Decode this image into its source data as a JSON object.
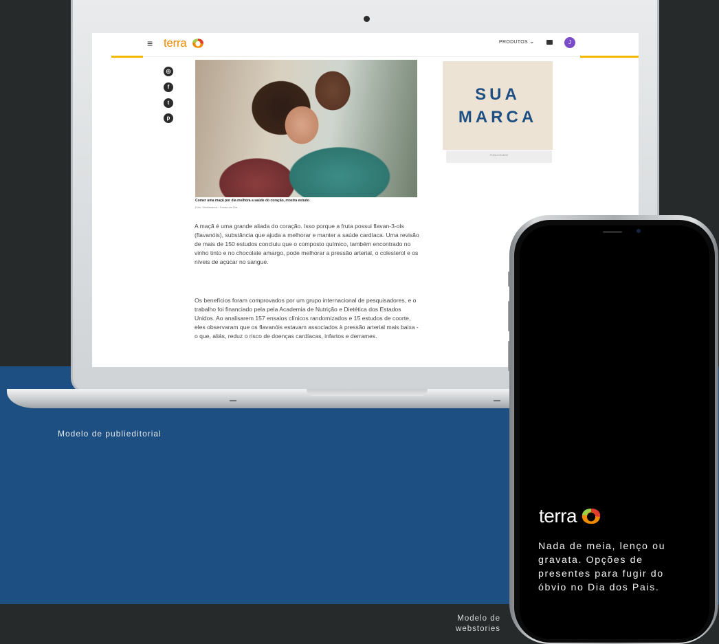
{
  "laptop": {
    "nav": {
      "menu_glyph": "≡",
      "logo_text": "terra",
      "products_label": "PRODUTOS",
      "products_chevron": "⌄",
      "avatar_initial": "J"
    },
    "social_icons": [
      "whatsapp-icon",
      "facebook-icon",
      "twitter-icon",
      "pinterest-icon"
    ],
    "article": {
      "photo_caption": "Comer uma maçã por dia melhora a saúde do coração, mostra estudo",
      "photo_credit": "Foto: Shutterstock / Saúde em Dia",
      "paragraph_1": "A maçã é uma grande aliada do coração. Isso porque a fruta possui flavan-3-ols (flavanóis), substância que ajuda a melhorar e manter a saúde cardíaca. Uma revisão de mais de 150 estudos concluiu que o composto químico, também encontrado no vinho tinto e no chocolate amargo, pode melhorar a pressão arterial, o colesterol e os níveis de açúcar no sangue.",
      "paragraph_2": "Os benefícios foram comprovados por um grupo internacional de pesquisadores, e o trabalho foi financiado pela pela Academia de Nutrição e Dietética dos Estados Unidos. Ao analisarem 157 ensaios clínicos randomizados e 15 estudos de coorte, eles observaram que os flavanóis estavam associados à pressão arterial mais baixa - o que, aliás, reduz o risco de doenças cardíacas, infartos e derrames."
    },
    "ad": {
      "text": "SUA\nMARCA",
      "label": "PUBLICIDADE"
    }
  },
  "captions": {
    "publieditorial": "Modelo de publieditorial",
    "webstories": "Modelo de webstories"
  },
  "phone": {
    "logo_text": "terra",
    "story_text": "Nada de meia, lenço ou gravata. Opções de presentes para fugir do óbvio no Dia dos Pais."
  },
  "colors": {
    "background": "#262a2b",
    "brand_blue": "#1d4f83",
    "terra_orange": "#f28a00",
    "nav_accent_yellow": "#f5b800",
    "ad_beige": "#ece3d4"
  }
}
